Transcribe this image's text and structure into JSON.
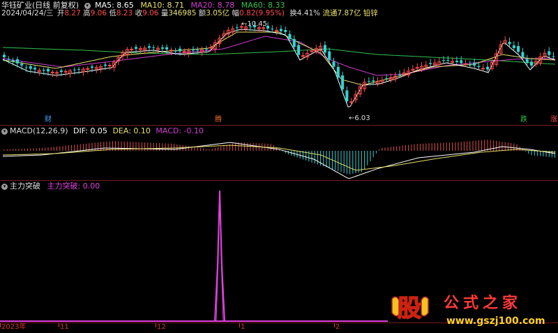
{
  "header": {
    "stock_name": "华钰矿业(日线 前复权)",
    "ma5_label": "MA5: 8.65",
    "ma10_label": "MA10: 8.71",
    "ma20_label": "MA20: 8.78",
    "ma60_label": "MA60: 8.33",
    "date": "2024/04/24/三",
    "open_label": "开",
    "open_value": "8.27",
    "high_label": "高",
    "high_value": "9.06",
    "low_label": "低",
    "low_value": "8.23",
    "close_label": "收",
    "close_value": "9.06",
    "volume_label": "量",
    "volume_value": "346985",
    "amount_label": "额",
    "amount_value": "3.05亿",
    "change_label": "幅",
    "change_value": "0.82(9.95%)",
    "turnover": "换4.41%",
    "float_label": "流通7.87亿",
    "sector": "铅锌"
  },
  "price_chart": {
    "high_marker": "10.45",
    "low_marker": "6.03",
    "badges": [
      "财",
      "腾",
      "跌",
      "涨"
    ]
  },
  "macd_panel": {
    "title": "MACD(12,26,9)",
    "dif": "DIF: 0.05",
    "dea": "DEA: 0.10",
    "macd": "MACD: -0.10"
  },
  "zhuli_panel": {
    "title": "主力突破",
    "value_label": "主力突破: 0.00"
  },
  "time_axis": [
    "2023年",
    "11",
    "12",
    "1",
    "2"
  ],
  "watermark": {
    "logo_char": "股",
    "brand": "公式之家",
    "url": "www.gszj100.com"
  },
  "colors": {
    "ma5": "#ffffff",
    "ma10": "#e8e06a",
    "ma20": "#d23cd2",
    "ma60": "#34c34a",
    "up": "#ff4a4a",
    "down": "#2fd6d6",
    "zhuli": "#e040e0"
  }
}
